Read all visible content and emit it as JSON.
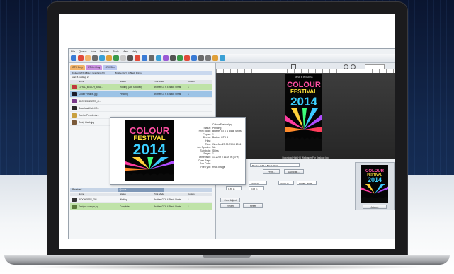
{
  "menu": [
    "File",
    "Queue",
    "Jobs",
    "Devices",
    "Tools",
    "View",
    "Help"
  ],
  "tabs": [
    "GTX Grey",
    "GTXm Gray",
    "GTX Sim"
  ],
  "printer_bar": "Brother GTX 4 Black Graphics (R)",
  "printer_bar_right": "Brother GTX 4 Black Prints",
  "total": "total: 6 holding: 2",
  "columns": [
    "Name",
    "Status",
    "Print Mode",
    "Copies"
  ],
  "jobs": [
    {
      "name": "LOYAL_BEACH_BRA...",
      "status": "Holding (Job Spooled)",
      "mode": "Brother GTX 4 Black Shirts",
      "copies": "1",
      "style": "green",
      "thumb": "#c0393b"
    },
    {
      "name": "Colour Festival.jpg",
      "status": "Pending",
      "mode": "Brother GTX 4 Black Shirts",
      "copies": "1",
      "style": "sel",
      "thumb": "#1d1d2b"
    },
    {
      "name": "SEGVESHEIETE_G...",
      "status": "",
      "mode": "",
      "copies": "",
      "style": "",
      "thumb": "#7a3a8a"
    },
    {
      "name": "Download Hub-HD...",
      "status": "",
      "mode": "",
      "copies": "",
      "style": "",
      "thumb": "#2a2a2a"
    },
    {
      "name": "Eco for Presidents...",
      "status": "",
      "mode": "",
      "copies": "",
      "style": "",
      "thumb": "#c8a040"
    },
    {
      "name": "Rusty tricab.jpg",
      "status": "",
      "mode": "",
      "copies": "",
      "style": "",
      "thumb": "#7a5a3a"
    }
  ],
  "bottom_tabs": [
    "Received",
    "Queue",
    ""
  ],
  "bottom_columns": [
    "Name",
    "Status",
    "Print Mode",
    "Copies"
  ],
  "bottom_jobs": [
    {
      "name": "BIOCHERRY_GH...",
      "status": "Waiting",
      "mode": "Brother GTX 4 Black Shirts",
      "copies": "1",
      "style": "",
      "thumb": "#333"
    },
    {
      "name": "Designs change.jpg",
      "status": "Complete",
      "mode": "Brother GTX 4 Black Shirts",
      "copies": "1",
      "style": "green",
      "thumb": "#5a7a3a"
    }
  ],
  "popup": {
    "rows": [
      {
        "k": "",
        "v": "Colour Festival.jpg"
      },
      {
        "k": "Status:",
        "v": "Pending"
      },
      {
        "k": "Print Mode:",
        "v": "Brother GTX 4 Black Shirts"
      },
      {
        "k": "Copies:",
        "v": "1"
      },
      {
        "k": "Device:",
        "v": "Brother GTX 4"
      },
      {
        "k": "Host:",
        "v": ""
      },
      {
        "k": "Time:",
        "v": "Wed Apr 23 09:29:13 2016"
      },
      {
        "k": "Job Spooled:",
        "v": "No"
      },
      {
        "k": "Substrate:",
        "v": "Shirts"
      },
      {
        "k": "Pages:",
        "v": "1"
      },
      {
        "k": "Dimension:",
        "v": "13.20 in x 16.00 in (47%)"
      },
      {
        "k": "Open Page:",
        "v": ""
      },
      {
        "k": "Job Code:",
        "v": ""
      },
      {
        "k": "File Type:",
        "v": "RGB Image"
      }
    ]
  },
  "poster": {
    "line1": "COLOUR",
    "line2": "FESTIVAL",
    "line3": "2014",
    "top_text": "MUSIC IN PROGRESS",
    "bottom_text": "Download Hub-HD Wallpaper For Desktop jpg"
  },
  "props": {
    "tabs": [
      "Color",
      "Job"
    ],
    "device": "Brother GTX 4 Black Shirts",
    "btn_print": "Print...",
    "btn_duplicate": "Duplicate...",
    "file": "Colour Festival.jpg",
    "width": "13.20 in",
    "height": "16.00 in",
    "scale": "47.06 %",
    "x": "1.39 in",
    "y": "0.03 in",
    "border": "Border: None",
    "btn_color": "Color Adjust",
    "btn_revert": "Revert",
    "btn_reset": "Reset",
    "preview_caption": "Artwork"
  },
  "colors": {
    "green_row": "#bfe3a8",
    "sel_row": "#9cc3e6",
    "tab_orange": "#f1b36a",
    "tab_purple": "#c990e0"
  }
}
